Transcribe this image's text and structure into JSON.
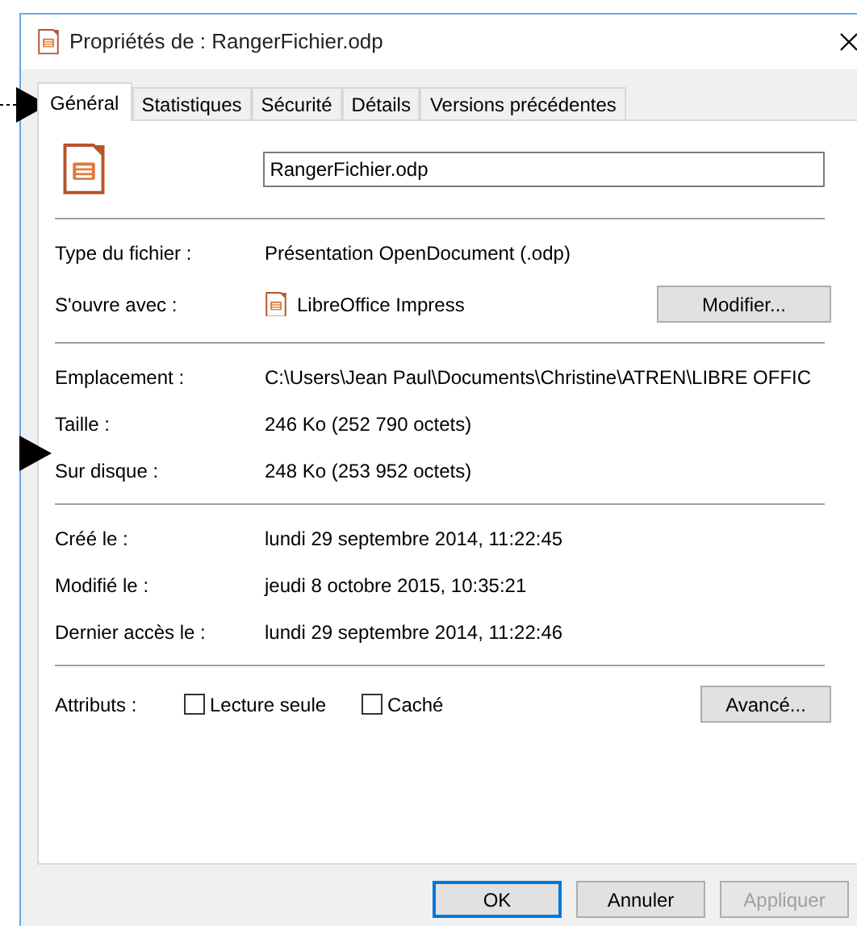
{
  "window": {
    "title": "Propriétés de : RangerFichier.odp"
  },
  "tabs": [
    {
      "label": "Général",
      "selected": true
    },
    {
      "label": "Statistiques",
      "selected": false
    },
    {
      "label": "Sécurité",
      "selected": false
    },
    {
      "label": "Détails",
      "selected": false
    },
    {
      "label": "Versions précédentes",
      "selected": false
    }
  ],
  "file_name": "RangerFichier.odp",
  "sections": [
    [
      {
        "label": "Type du fichier :",
        "value": "Présentation OpenDocument (.odp)"
      },
      {
        "label": "S'ouvre avec :",
        "value": "LibreOffice Impress",
        "kind": "app",
        "button": "Modifier..."
      }
    ],
    [
      {
        "label": "Emplacement :",
        "value": "C:\\Users\\Jean Paul\\Documents\\Christine\\ATREN\\LIBRE OFFIC"
      },
      {
        "label": "Taille :",
        "value": "246 Ko (252 790 octets)"
      },
      {
        "label": "Sur disque :",
        "value": "248 Ko (253 952 octets)"
      }
    ],
    [
      {
        "label": "Créé le :",
        "value": "lundi 29 septembre 2014, 11:22:45"
      },
      {
        "label": "Modifié le :",
        "value": "jeudi 8 octobre 2015, 10:35:21"
      },
      {
        "label": "Dernier accès le :",
        "value": "lundi 29 septembre 2014, 11:22:46"
      }
    ]
  ],
  "attributes": {
    "label": "Attributs :",
    "checkboxes": [
      {
        "label": "Lecture seule",
        "checked": false
      },
      {
        "label": "Caché",
        "checked": false
      }
    ],
    "button": "Avancé..."
  },
  "buttons": [
    {
      "label": "OK",
      "default": true,
      "disabled": false
    },
    {
      "label": "Annuler",
      "default": false,
      "disabled": false
    },
    {
      "label": "Appliquer",
      "default": false,
      "disabled": true
    }
  ]
}
